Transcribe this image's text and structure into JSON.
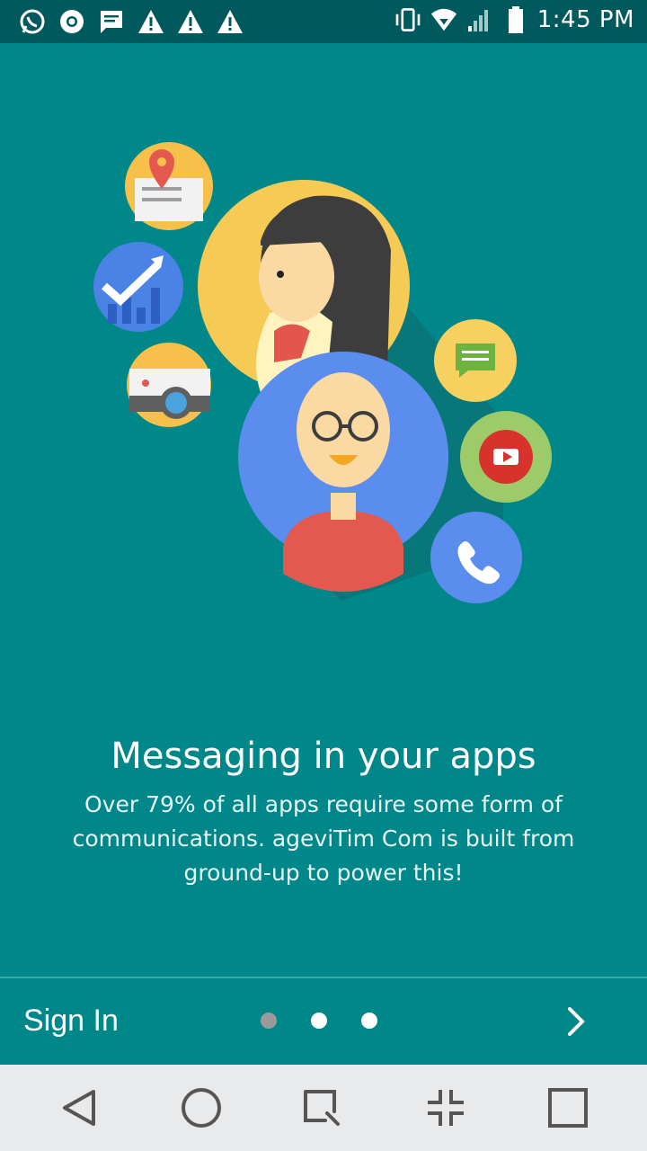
{
  "status_bar": {
    "time": "1:45 PM",
    "left_icons": [
      "whatsapp-icon",
      "chrome-icon",
      "message-icon",
      "warning-icon",
      "warning-icon",
      "warning-icon"
    ],
    "right_icons": [
      "vibrate-icon",
      "wifi-icon",
      "signal-icon",
      "battery-icon"
    ]
  },
  "onboarding": {
    "title": "Messaging in your apps",
    "description": "Over 79% of all apps require some form of communications. ageviTim Com is built from ground-up to power this!"
  },
  "bottom_bar": {
    "sign_in_label": "Sign In",
    "page_count": 3,
    "active_page": 1
  },
  "colors": {
    "background": "#00878a",
    "status_bar": "#00595c",
    "nav_bar": "#e9eaec"
  }
}
